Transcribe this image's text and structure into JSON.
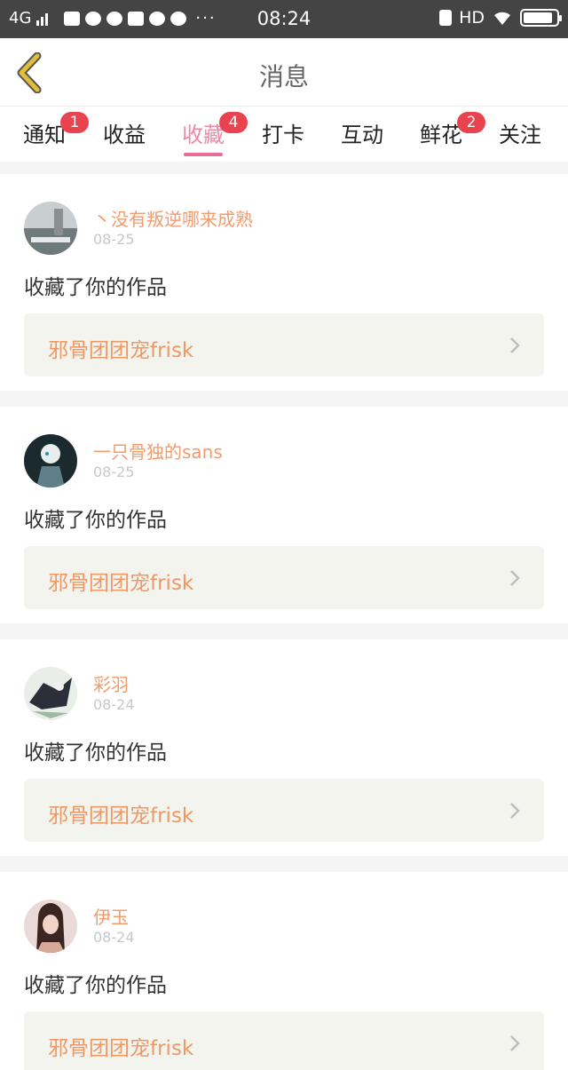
{
  "status_bar": {
    "network": "4G",
    "time": "08:24",
    "hd_label": "HD",
    "battery_level": 0.9
  },
  "header": {
    "title": "消息"
  },
  "tabs": [
    {
      "label": "通知",
      "badge": "1"
    },
    {
      "label": "收益",
      "badge": ""
    },
    {
      "label": "收藏",
      "badge": "4",
      "active": true
    },
    {
      "label": "打卡",
      "badge": ""
    },
    {
      "label": "互动",
      "badge": ""
    },
    {
      "label": "鲜花",
      "badge": "2"
    },
    {
      "label": "关注",
      "badge": ""
    }
  ],
  "messages": [
    {
      "username": "丶没有叛逆哪来成熟",
      "date": "08-25",
      "action": "收藏了你的作品",
      "work_title": "邪骨团团宠frisk"
    },
    {
      "username": "一只骨独的sans",
      "date": "08-25",
      "action": "收藏了你的作品",
      "work_title": "邪骨团团宠frisk"
    },
    {
      "username": "彩羽",
      "date": "08-24",
      "action": "收藏了你的作品",
      "work_title": "邪骨团团宠frisk"
    },
    {
      "username": "伊玉",
      "date": "08-24",
      "action": "收藏了你的作品",
      "work_title": "邪骨团团宠frisk"
    }
  ],
  "colors": {
    "accent_pink": "#e98aa6",
    "badge_red": "#e8434f",
    "username_orange": "#f29b6c",
    "work_orange": "#ee9866",
    "back_arrow_gold": "#e2bd3a"
  }
}
